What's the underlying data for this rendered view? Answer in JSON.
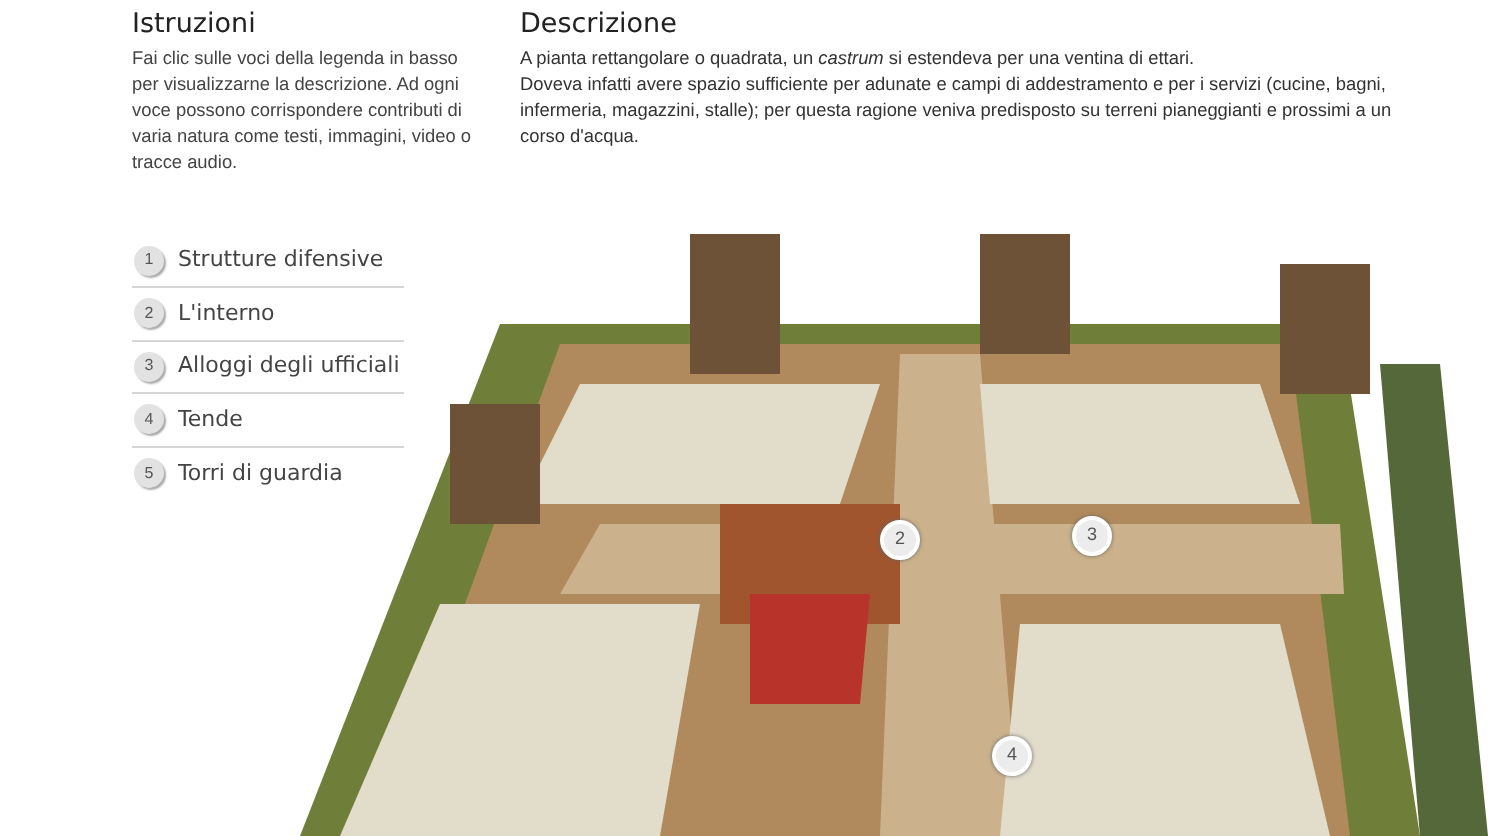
{
  "instructions": {
    "title": "Istruzioni",
    "text": "Fai clic sulle voci della legenda in basso per visualizzarne la descrizione. Ad ogni voce possono corrispondere contributi di varia natura come testi, immagini, video o tracce audio."
  },
  "legend": [
    {
      "number": "1",
      "label": "Strutture difensive"
    },
    {
      "number": "2",
      "label": "L'interno"
    },
    {
      "number": "3",
      "label": "Alloggi degli ufficiali"
    },
    {
      "number": "4",
      "label": "Tende"
    },
    {
      "number": "5",
      "label": "Torri di guardia"
    }
  ],
  "description": {
    "title": "Descrizione",
    "paragraphs": [
      "A pianta rettangolare o quadrata, un *castrum* si estendeva per una ventina di ettari.",
      "Doveva infatti avere spazio sufficiente per adunate e campi di addestramento e per i servizi (cucine, bagni, infermeria, magazzini, stalle); per questa ragione veniva predisposto su terreni pianeggianti e prossimi a un corso d'acqua."
    ]
  },
  "illustration": {
    "markers": [
      {
        "number": "2"
      },
      {
        "number": "3"
      },
      {
        "number": "4"
      }
    ]
  }
}
